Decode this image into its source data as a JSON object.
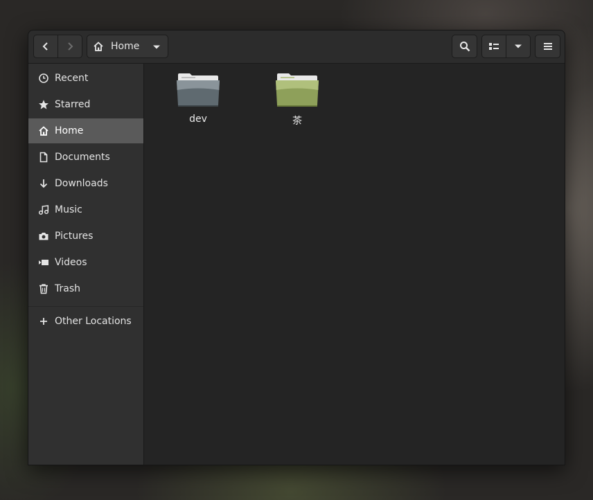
{
  "header": {
    "back_icon": "chevron-left-icon",
    "forward_icon": "chevron-right-icon",
    "location_label": "Home",
    "location_icon": "home-icon",
    "search_icon": "search-icon",
    "view_icon": "list-view-icon",
    "view_options_icon": "chevron-down-icon",
    "menu_icon": "hamburger-icon"
  },
  "sidebar": {
    "items": [
      {
        "label": "Recent",
        "icon": "clock-icon"
      },
      {
        "label": "Starred",
        "icon": "star-icon"
      },
      {
        "label": "Home",
        "icon": "home-icon",
        "active": true
      },
      {
        "label": "Documents",
        "icon": "document-icon"
      },
      {
        "label": "Downloads",
        "icon": "download-icon"
      },
      {
        "label": "Music",
        "icon": "music-icon"
      },
      {
        "label": "Pictures",
        "icon": "camera-icon"
      },
      {
        "label": "Videos",
        "icon": "video-icon"
      },
      {
        "label": "Trash",
        "icon": "trash-icon"
      }
    ],
    "other_locations": {
      "label": "Other Locations",
      "icon": "plus-icon"
    }
  },
  "files": [
    {
      "name": "dev",
      "color": "#5f6a70"
    },
    {
      "name": "茶",
      "color": "#8ea05a"
    }
  ],
  "colors": {
    "window_bg": "#242424",
    "sidebar_bg": "#303030",
    "active_item": "#5a5a5a"
  }
}
